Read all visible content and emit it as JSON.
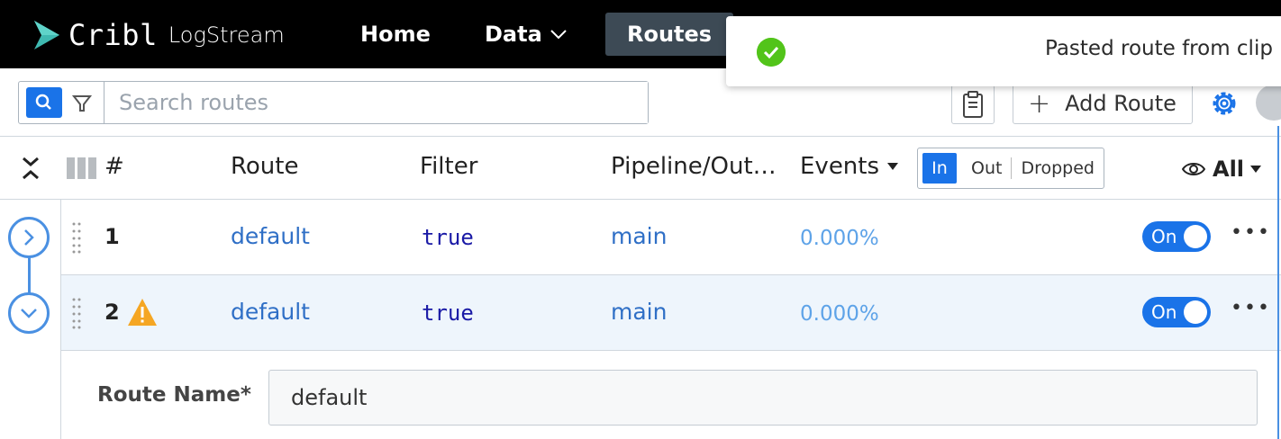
{
  "app": {
    "brand": "Cribl",
    "product": "LogStream"
  },
  "nav": {
    "home": "Home",
    "data": "Data",
    "routes": "Routes"
  },
  "toast": {
    "message": "Pasted route from clip"
  },
  "toolbar": {
    "search_placeholder": "Search routes",
    "add_route_label": "Add Route"
  },
  "table": {
    "headers": {
      "num": "#",
      "route": "Route",
      "filter": "Filter",
      "pipeline": "Pipeline/Out…",
      "events": "Events"
    },
    "event_toggle": {
      "in": "In",
      "out": "Out",
      "dropped": "Dropped",
      "selected": "In"
    },
    "view": "All",
    "rows": [
      {
        "num": "1",
        "route": "default",
        "filter": "true",
        "pipeline": "main",
        "events": "0.000%",
        "toggle": "On",
        "warning": false
      },
      {
        "num": "2",
        "route": "default",
        "filter": "true",
        "pipeline": "main",
        "events": "0.000%",
        "toggle": "On",
        "warning": true
      }
    ]
  },
  "detail": {
    "route_name_label": "Route Name*",
    "route_name_value": "default"
  },
  "icons": {
    "logo": "cribl-logo-icon",
    "search": "search-icon",
    "filter": "funnel-icon",
    "paste": "clipboard-icon",
    "settings": "gear-icon",
    "success": "check-circle-icon",
    "warning": "warning-triangle-icon"
  },
  "colors": {
    "accent": "#1a73e8",
    "link": "#2f6fc6",
    "success": "#52c41a",
    "warning": "#f5a623",
    "topbar": "#000000"
  }
}
